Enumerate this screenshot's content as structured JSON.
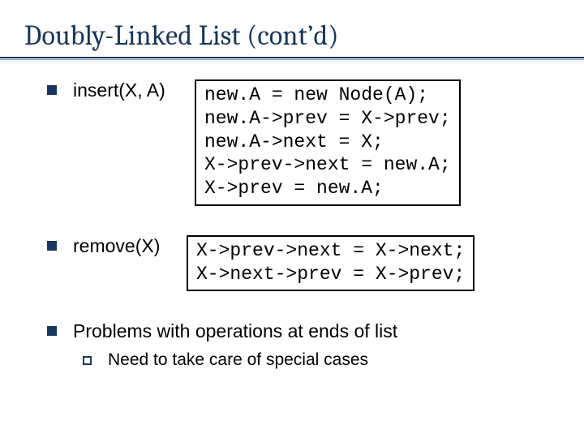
{
  "title": "Doubly-Linked List (cont’d)",
  "items": {
    "insert": {
      "label": "insert(X, A)",
      "code": "new.A = new Node(A);\nnew.A->prev = X->prev;\nnew.A->next = X;\nX->prev->next = new.A;\nX->prev = new.A;"
    },
    "remove": {
      "label": "remove(X)",
      "code": "X->prev->next = X->next;\nX->next->prev = X->prev;"
    },
    "problems": {
      "text": "Problems with operations at ends of list",
      "sub": "Need to take care of special cases"
    }
  }
}
